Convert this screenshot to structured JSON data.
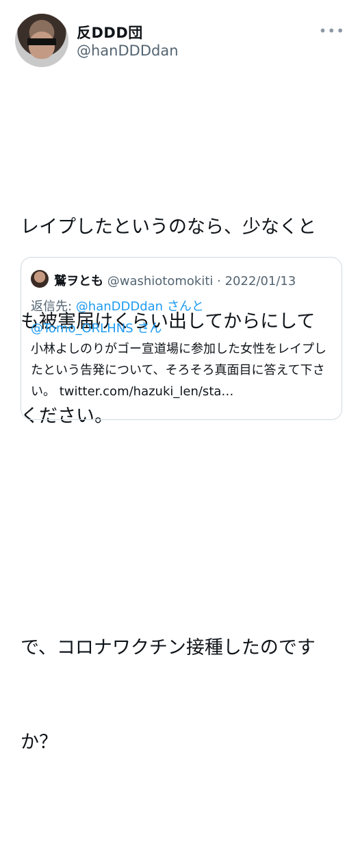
{
  "tweet": {
    "author_name": "反DDD団",
    "author_handle": "@hanDDDdan",
    "more_icon": "•••",
    "text_lines": [
      "レイプしたというのなら、少なくと",
      "も被害届けくらい出してからにして",
      "ください。"
    ],
    "text_lines_2": [
      "で、コロナワクチン接種したのです",
      "か？"
    ]
  },
  "quote": {
    "author_name": "鷲ヲとも",
    "author_handle": "@washiotomokiti",
    "separator": "·",
    "date": "2022/01/13",
    "reply_label": "返信先: ",
    "reply_mention_1": "@hanDDDdan",
    "reply_suffix_1": "さんと",
    "reply_mention_2": "@Tomo_ORLHNS",
    "reply_suffix_2": "さん",
    "body": "小林よしのりがゴー宣道場に参加した女性をレイプしたという告発について、そろそろ真面目に答えて下さい。 twitter.com/hazuki_len/sta…"
  }
}
